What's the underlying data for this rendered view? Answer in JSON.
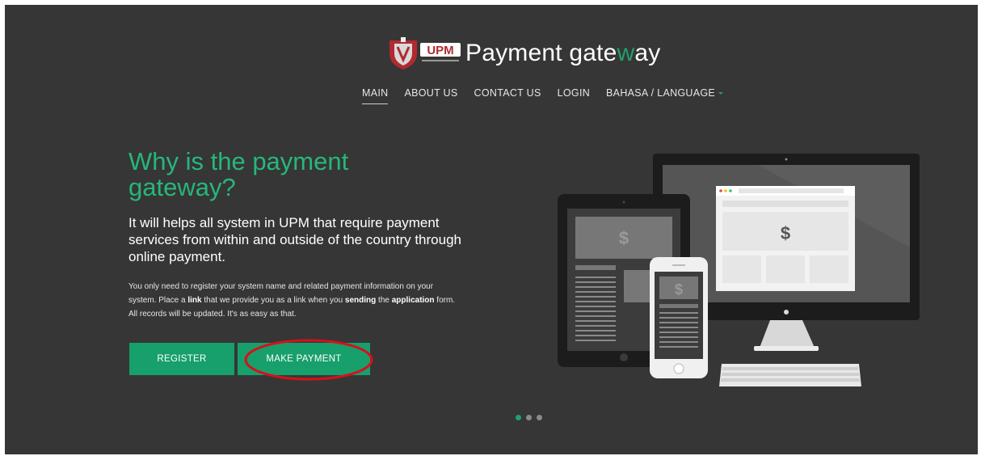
{
  "brand": {
    "logo_text": "UPM",
    "title_prefix": "Payment gate",
    "title_accent": "w",
    "title_suffix": "ay",
    "accent_color": "#1fa06c"
  },
  "nav": {
    "items": [
      "MAIN",
      "ABOUT US",
      "CONTACT US",
      "LOGIN",
      "BAHASA / LANGUAGE"
    ],
    "active": "MAIN"
  },
  "hero": {
    "headline": "Why is the payment gateway?",
    "subhead": "It will helps all system in UPM that require payment services from within and outside of the country through online payment.",
    "body_parts": [
      {
        "text": "You only need to register your system name and related payment information on your system. Place a ",
        "bold": false
      },
      {
        "text": "link",
        "bold": true
      },
      {
        "text": " that we provide you as a link when you ",
        "bold": false
      },
      {
        "text": "sending",
        "bold": true
      },
      {
        "text": " the ",
        "bold": false
      },
      {
        "text": "application",
        "bold": true
      },
      {
        "text": " form. All records will be updated. It's as easy as that.",
        "bold": false
      }
    ],
    "register_label": "REGISTER",
    "payment_label": "MAKE PAYMENT"
  },
  "devices": {
    "currency_symbol": "$"
  },
  "carousel": {
    "slide_count": 3,
    "active_index": 0
  }
}
